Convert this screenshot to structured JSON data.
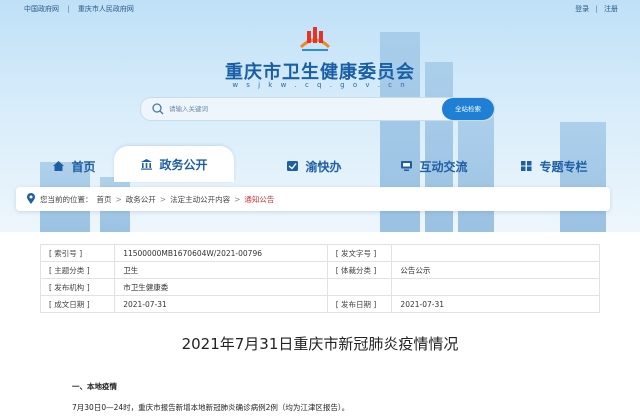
{
  "topbar": {
    "links": [
      "中国政府网",
      "重庆市人民政府网"
    ],
    "separator": "|",
    "login": "登录",
    "register": "注册"
  },
  "header": {
    "title": "重庆市卫生健康委员会",
    "subtitle": "w s j k w . c q . g o v . c n"
  },
  "search": {
    "placeholder": "请输入关键词",
    "button": "全站检索"
  },
  "nav": {
    "tabs": [
      {
        "label": "首页",
        "icon": "home-icon",
        "active": false
      },
      {
        "label": "政务公开",
        "icon": "government-building-icon",
        "active": true
      },
      {
        "label": "渝快办",
        "icon": "service-grid-icon",
        "active": false
      },
      {
        "label": "互动交流",
        "icon": "chat-monitor-icon",
        "active": false
      },
      {
        "label": "专题专栏",
        "icon": "topic-grid-icon",
        "active": false
      }
    ]
  },
  "breadcrumb": {
    "prefix": "您当前的位置：",
    "items": [
      "首页",
      "政务公开",
      "法定主动公开内容",
      "通知公告"
    ],
    "arrow": ">"
  },
  "meta": {
    "rows": [
      [
        "[ 索引号 ]",
        "11500000MB1670604W/2021-00796",
        "[ 发文字号 ]",
        ""
      ],
      [
        "[ 主题分类 ]",
        "卫生",
        "[ 体裁分类 ]",
        "公告公示"
      ],
      [
        "[ 发布机构 ]",
        "市卫生健康委",
        "",
        ""
      ],
      [
        "[ 成文日期 ]",
        "2021-07-31",
        "[ 发布日期 ]",
        "2021-07-31"
      ]
    ]
  },
  "article": {
    "title": "2021年7月31日重庆市新冠肺炎疫情情况",
    "section1": "一、本地疫情",
    "para1": "7月30日0—24时，重庆市报告新增本地新冠肺炎确诊病例2例（均为江津区报告）。"
  },
  "colors": {
    "brand": "#1a5fa6",
    "accent": "#1f7fd4",
    "current_crumb": "#cc3333"
  }
}
